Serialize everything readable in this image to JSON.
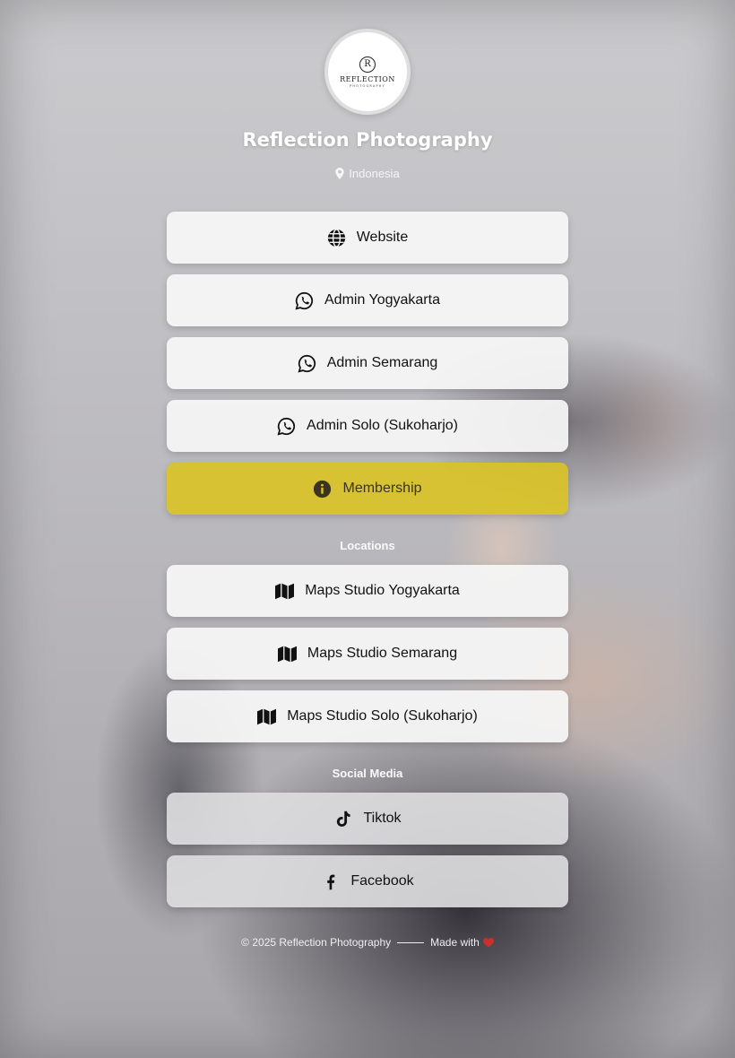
{
  "profile": {
    "logo_text": "REFLECTION",
    "logo_subtext": "PHOTOGRAPHY",
    "name": "Reflection Photography",
    "location": "Indonesia"
  },
  "links": [
    {
      "label": "Website",
      "icon": "globe-icon"
    },
    {
      "label": "Admin Yogyakarta",
      "icon": "whatsapp-icon"
    },
    {
      "label": "Admin Semarang",
      "icon": "whatsapp-icon"
    },
    {
      "label": "Admin Solo (Sukoharjo)",
      "icon": "whatsapp-icon"
    },
    {
      "label": "Membership",
      "icon": "info-icon",
      "color": "#d8c226"
    }
  ],
  "locations": {
    "heading": "Locations",
    "links": [
      {
        "label": "Maps Studio Yogyakarta",
        "icon": "map-icon"
      },
      {
        "label": "Maps Studio Semarang",
        "icon": "map-icon"
      },
      {
        "label": "Maps Studio Solo (Sukoharjo)",
        "icon": "map-icon"
      }
    ]
  },
  "social": {
    "heading": "Social Media",
    "links": [
      {
        "label": "Tiktok",
        "icon": "tiktok-icon"
      },
      {
        "label": "Facebook",
        "icon": "facebook-icon"
      }
    ]
  },
  "footer": {
    "copyright": "© 2025 Reflection Photography",
    "made_with": "Made with",
    "heart_icon": "heart-icon"
  }
}
